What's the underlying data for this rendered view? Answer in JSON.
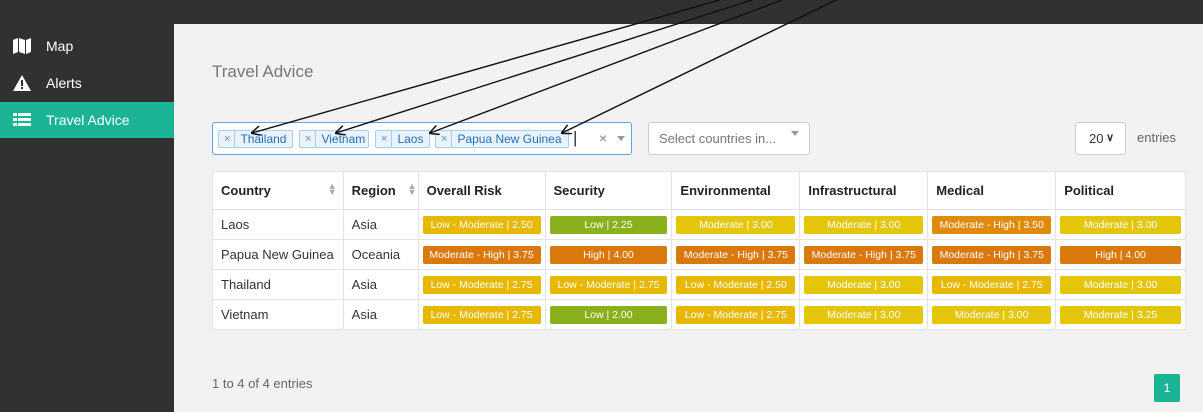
{
  "sidebar": {
    "items": [
      {
        "label": "Map",
        "icon": "map-icon"
      },
      {
        "label": "Alerts",
        "icon": "warning-icon"
      },
      {
        "label": "Travel Advice",
        "icon": "list-icon"
      }
    ]
  },
  "page": {
    "title": "Travel Advice"
  },
  "filters": {
    "tags": [
      "Thailand",
      "Vietnam",
      "Laos",
      "Papua New Guinea"
    ],
    "tag_remove": "×",
    "clear": "×",
    "region_placeholder": "Select countries in..."
  },
  "length": {
    "value": "20",
    "label": "entries"
  },
  "table": {
    "headers": [
      "Country",
      "Region",
      "Overall Risk",
      "Security",
      "Environmental",
      "Infrastructural",
      "Medical",
      "Political"
    ],
    "rows": [
      {
        "country": "Laos",
        "region": "Asia",
        "cells": [
          {
            "text": "Low - Moderate | 2.50",
            "color": "#e6b800"
          },
          {
            "text": "Low | 2.25",
            "color": "#8ab01e"
          },
          {
            "text": "Moderate | 3.00",
            "color": "#e3c60a"
          },
          {
            "text": "Moderate | 3.00",
            "color": "#e3c60a"
          },
          {
            "text": "Moderate - High | 3.50",
            "color": "#e08a0b"
          },
          {
            "text": "Moderate | 3.00",
            "color": "#e3c60a"
          }
        ]
      },
      {
        "country": "Papua New Guinea",
        "region": "Oceania",
        "cells": [
          {
            "text": "Moderate - High | 3.75",
            "color": "#d9780c"
          },
          {
            "text": "High | 4.00",
            "color": "#d9780c"
          },
          {
            "text": "Moderate - High | 3.75",
            "color": "#d9780c"
          },
          {
            "text": "Moderate - High | 3.75",
            "color": "#d9780c"
          },
          {
            "text": "Moderate - High | 3.75",
            "color": "#d9780c"
          },
          {
            "text": "High | 4.00",
            "color": "#d9780c"
          }
        ]
      },
      {
        "country": "Thailand",
        "region": "Asia",
        "cells": [
          {
            "text": "Low - Moderate | 2.75",
            "color": "#e6b800"
          },
          {
            "text": "Low - Moderate | 2.75",
            "color": "#e6b800"
          },
          {
            "text": "Low - Moderate | 2.50",
            "color": "#e6b800"
          },
          {
            "text": "Moderate | 3.00",
            "color": "#e3c60a"
          },
          {
            "text": "Low - Moderate | 2.75",
            "color": "#e6b800"
          },
          {
            "text": "Moderate | 3.00",
            "color": "#e3c60a"
          }
        ]
      },
      {
        "country": "Vietnam",
        "region": "Asia",
        "cells": [
          {
            "text": "Low - Moderate | 2.75",
            "color": "#e6b800"
          },
          {
            "text": "Low | 2.00",
            "color": "#8ab01e"
          },
          {
            "text": "Low - Moderate | 2.75",
            "color": "#e6b800"
          },
          {
            "text": "Moderate | 3.00",
            "color": "#e3c60a"
          },
          {
            "text": "Moderate | 3.00",
            "color": "#e3c60a"
          },
          {
            "text": "Moderate | 3.25",
            "color": "#e3c60a"
          }
        ]
      }
    ]
  },
  "footer": {
    "info": "1 to 4 of 4 entries",
    "page": "1"
  },
  "colors": {
    "accent": "#1ab394",
    "sidebar": "#2f3133"
  }
}
